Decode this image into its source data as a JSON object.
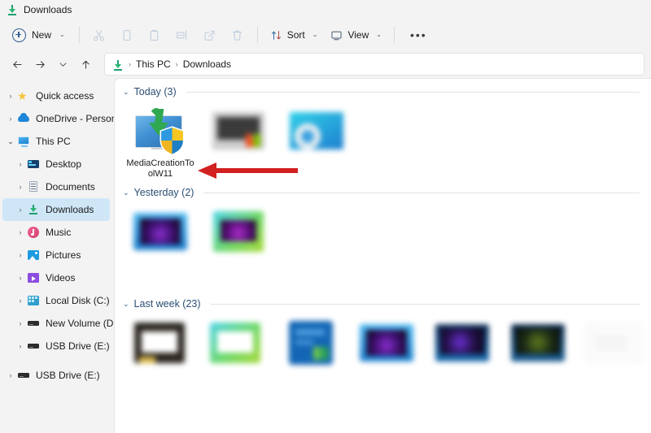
{
  "window": {
    "title": "Downloads",
    "title_icon": "downloads-icon"
  },
  "toolbar": {
    "new_label": "New",
    "new_chevron": "⌄",
    "cut_label": "Cut",
    "copy_label": "Copy",
    "paste_label": "Paste",
    "rename_label": "Rename",
    "share_label": "Share",
    "delete_label": "Delete",
    "sort_label": "Sort",
    "view_label": "View",
    "more_label": "See more",
    "more_glyph": "•••",
    "chevron": "⌄"
  },
  "address": {
    "back_label": "Back",
    "forward_label": "Forward",
    "recent_label": "Recent locations",
    "up_label": "Up",
    "icon": "downloads-icon",
    "crumbs": [
      "This PC",
      "Downloads"
    ],
    "separator": "›"
  },
  "sidebar": {
    "items": [
      {
        "label": "Quick access",
        "icon": "star-icon",
        "level": 0,
        "expander": "›",
        "expanded": false,
        "selected": false
      },
      {
        "label": "OneDrive - Personal",
        "icon": "cloud-icon",
        "level": 0,
        "expander": "›",
        "expanded": false,
        "selected": false
      },
      {
        "label": "This PC",
        "icon": "pc-icon",
        "level": 0,
        "expander": "⌄",
        "expanded": true,
        "selected": false
      },
      {
        "label": "Desktop",
        "icon": "desktop-icon",
        "level": 1,
        "expander": "›",
        "expanded": false,
        "selected": false
      },
      {
        "label": "Documents",
        "icon": "documents-icon",
        "level": 1,
        "expander": "›",
        "expanded": false,
        "selected": false
      },
      {
        "label": "Downloads",
        "icon": "downloads-icon",
        "level": 1,
        "expander": "›",
        "expanded": false,
        "selected": true
      },
      {
        "label": "Music",
        "icon": "music-icon",
        "level": 1,
        "expander": "›",
        "expanded": false,
        "selected": false
      },
      {
        "label": "Pictures",
        "icon": "pictures-icon",
        "level": 1,
        "expander": "›",
        "expanded": false,
        "selected": false
      },
      {
        "label": "Videos",
        "icon": "videos-icon",
        "level": 1,
        "expander": "›",
        "expanded": false,
        "selected": false
      },
      {
        "label": "Local Disk (C:)",
        "icon": "disk-icon",
        "level": 1,
        "expander": "›",
        "expanded": false,
        "selected": false
      },
      {
        "label": "New Volume (D:)",
        "icon": "drive-icon",
        "level": 1,
        "expander": "›",
        "expanded": false,
        "selected": false
      },
      {
        "label": "USB Drive (E:)",
        "icon": "drive-icon",
        "level": 1,
        "expander": "›",
        "expanded": false,
        "selected": false
      },
      {
        "label": "USB Drive (E:)",
        "icon": "drive-icon",
        "level": 0,
        "expander": "›",
        "expanded": false,
        "selected": false
      }
    ]
  },
  "content": {
    "groups": [
      {
        "label": "Today (3)",
        "chevron": "⌄",
        "items": [
          {
            "name": "MediaCreationToolW11",
            "thumb": "media-creation-tool",
            "blurred": false
          },
          {
            "name": "",
            "thumb": "grey-photo",
            "blurred": true
          },
          {
            "name": "",
            "thumb": "teal-monitor",
            "blurred": true
          }
        ]
      },
      {
        "label": "Yesterday (2)",
        "chevron": "⌄",
        "items": [
          {
            "name": "",
            "thumb": "blue-frame-screen",
            "blurred": true
          },
          {
            "name": "",
            "thumb": "green-frame-screen",
            "blurred": true
          }
        ]
      },
      {
        "label": "Last week (23)",
        "chevron": "⌄",
        "items": [
          {
            "name": "",
            "thumb": "dark-frame-photo",
            "blurred": true
          },
          {
            "name": "",
            "thumb": "green-frame-photo",
            "blurred": true
          },
          {
            "name": "",
            "thumb": "windows-setup",
            "blurred": true
          },
          {
            "name": "",
            "thumb": "blue-frame-screen",
            "blurred": true
          },
          {
            "name": "",
            "thumb": "navy-screen",
            "blurred": true
          },
          {
            "name": "",
            "thumb": "navy-screen-2",
            "blurred": true
          },
          {
            "name": "",
            "thumb": "faint-doc",
            "blurred": true
          }
        ]
      }
    ]
  },
  "annotation": {
    "type": "arrow",
    "color": "#d32020",
    "direction": "left",
    "points_to": "MediaCreationToolW11"
  },
  "colors": {
    "accent": "#0f6cbd",
    "selection": "#cfe6f7",
    "group_header": "#2a4d73",
    "chrome": "#f3f3f3",
    "pane": "#ffffff",
    "annotation_red": "#d32020"
  }
}
